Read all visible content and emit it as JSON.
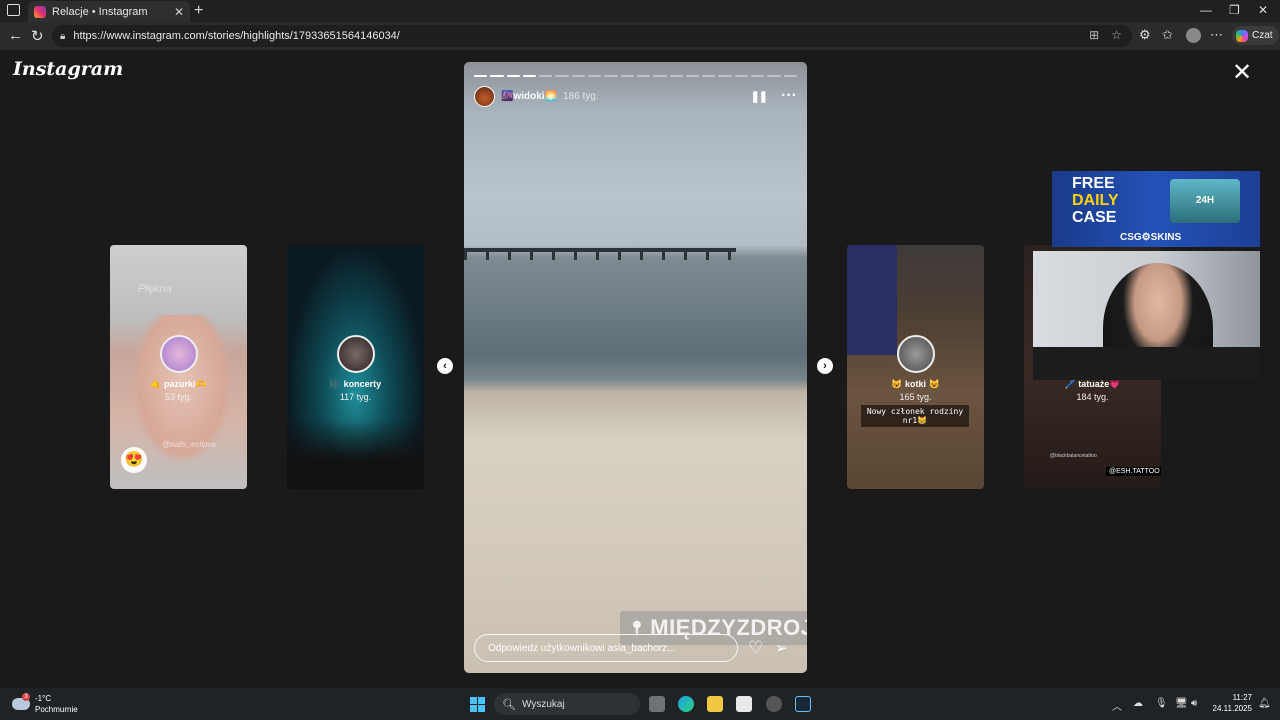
{
  "browser": {
    "tab_title": "Relacje • Instagram",
    "url": "https://www.instagram.com/stories/highlights/17933651564146034/",
    "copilot_label": "Czat"
  },
  "page": {
    "logo": "Instagram",
    "highlights": [
      {
        "title": "🤙 pazurki🫶",
        "age": "53 tyg."
      },
      {
        "title": "🎼 koncerty",
        "age": "117 tyg."
      },
      {
        "title": "😺 kotki 😺",
        "age": "165 tyg.",
        "caption": "Nowy członek rodziny nr1😸"
      },
      {
        "title": "🖊️ tatuaże💗",
        "age": "184 tyg.",
        "tag": "@ESH.TATTOO",
        "tag2": "@blackbalancetattoo"
      }
    ],
    "nails_watermark": "@nails_eclipse",
    "nails_watermark2": "Piękna",
    "story": {
      "segments_total": 20,
      "segments_done": 4,
      "name": "🌆widoki🌅",
      "age": "186 tyg.",
      "location": "MIĘDZYZDROJE",
      "reply_placeholder": "Odpowiedz użytkownikowi asia_bachorz..."
    }
  },
  "overlay": {
    "ad_line1": "FREE",
    "ad_line2": "DAILY",
    "ad_line3": "CASE",
    "ad_box": "24H",
    "ad_brand": "CSG⚙SKINS"
  },
  "taskbar": {
    "temp": "-1°C",
    "weather": "Pochmurnie",
    "weather_badge": "3",
    "search": "Wyszukaj",
    "time": "11:27",
    "date": "24.11.2025"
  }
}
